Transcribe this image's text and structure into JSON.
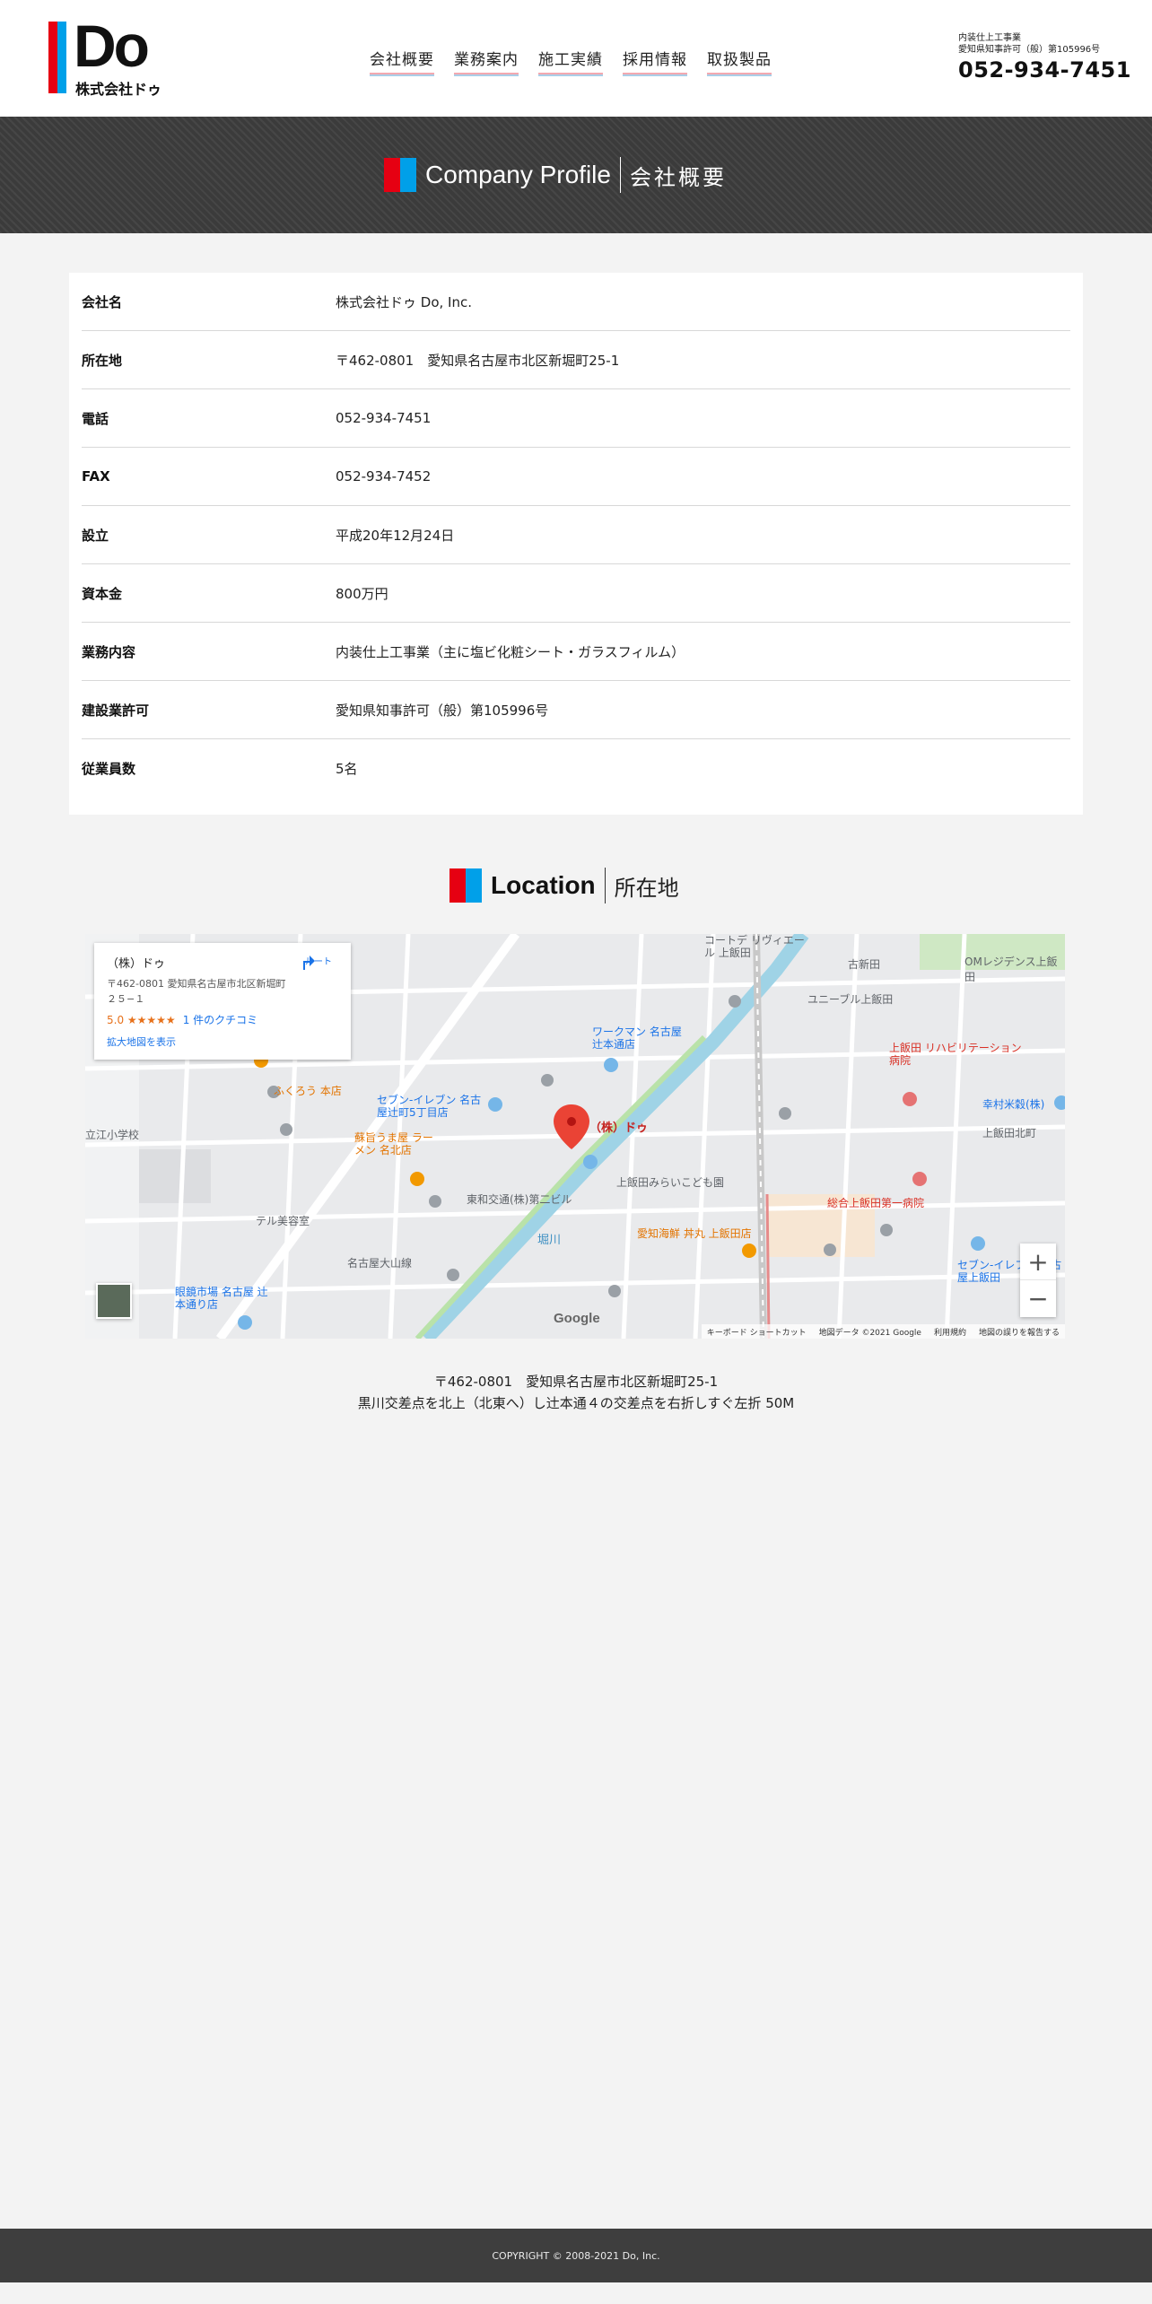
{
  "header": {
    "logo": {
      "mark": "Do",
      "sub": "株式会社ドゥ"
    },
    "nav": [
      "会社概要",
      "業務案内",
      "施工実績",
      "採用情報",
      "取扱製品"
    ],
    "contact": {
      "line1": "内装仕上工事業",
      "line2": "愛知県知事許可（般）第105996号",
      "tel": "052-934-7451"
    }
  },
  "banner": {
    "title_en": "Company Profile",
    "title_ja": "会社概要"
  },
  "profile": [
    {
      "label": "会社名",
      "value": "株式会社ドゥ Do, Inc."
    },
    {
      "label": "所在地",
      "value": "〒462-0801　愛知県名古屋市北区新堀町25-1"
    },
    {
      "label": "電話",
      "value": "052-934-7451"
    },
    {
      "label": "FAX",
      "value": "052-934-7452"
    },
    {
      "label": "設立",
      "value": "平成20年12月24日"
    },
    {
      "label": "資本金",
      "value": "800万円"
    },
    {
      "label": "業務内容",
      "value": "内装仕上工事業（主に塩ビ化粧シート・ガラスフィルム）"
    },
    {
      "label": "建設業許可",
      "value": "愛知県知事許可（般）第105996号"
    },
    {
      "label": "従業員数",
      "value": "5名"
    }
  ],
  "location": {
    "title_en": "Location",
    "title_ja": "所在地",
    "map": {
      "card": {
        "name": "（株）ドゥ",
        "address": "〒462-0801 愛知県名古屋市北区新堀町２５−１",
        "rating": "5.0 ★★★★★",
        "reviews": "1 件のクチコミ",
        "route": "ルート",
        "larger_map": "拡大地図を表示"
      },
      "marker_label": "（株）ドゥ",
      "labels": {
        "l1": "セブン-イレブン 名古屋辻町5丁目店",
        "l2": "ふくろう 本店",
        "l3": "蘇旨うま屋 ラーメン 名北店",
        "l4": "ワークマン 名古屋辻本通店",
        "l5": "上飯田みらいこども園",
        "l6": "総合上飯田第一病院",
        "l7": "上飯田 リハビリテーション病院",
        "l8": "愛知海鮮 丼丸 上飯田店",
        "l9": "眼鏡市場 名古屋 辻本通り店",
        "l10": "東和交通(株)第二ビル",
        "l11": "幸村米穀(株)",
        "l12": "ユニーブル上飯田",
        "l13": "コートデ リヴィエール 上飯田",
        "l14": "OMレジデンス上飯田",
        "l15": "堀川",
        "l16": "名古屋大山線",
        "l17": "テル美容室",
        "l18": "セブン-イレブン 名古屋上飯田",
        "l19": "上飯田北町",
        "l20": "立江小学校",
        "l21": "古新田"
      },
      "google": "Google",
      "footer": [
        "キーボード ショートカット",
        "地図データ ©2021 Google",
        "利用規約",
        "地図の誤りを報告する"
      ],
      "zoom_in": "+",
      "zoom_out": "−"
    },
    "address_line": "〒462-0801　愛知県名古屋市北区新堀町25-1",
    "directions": "黒川交差点を北上（北東へ）し辻本通４の交差点を右折しすぐ左折 50M"
  },
  "footer": {
    "copyright": "COPYRIGHT © 2008-2021 Do, Inc."
  }
}
